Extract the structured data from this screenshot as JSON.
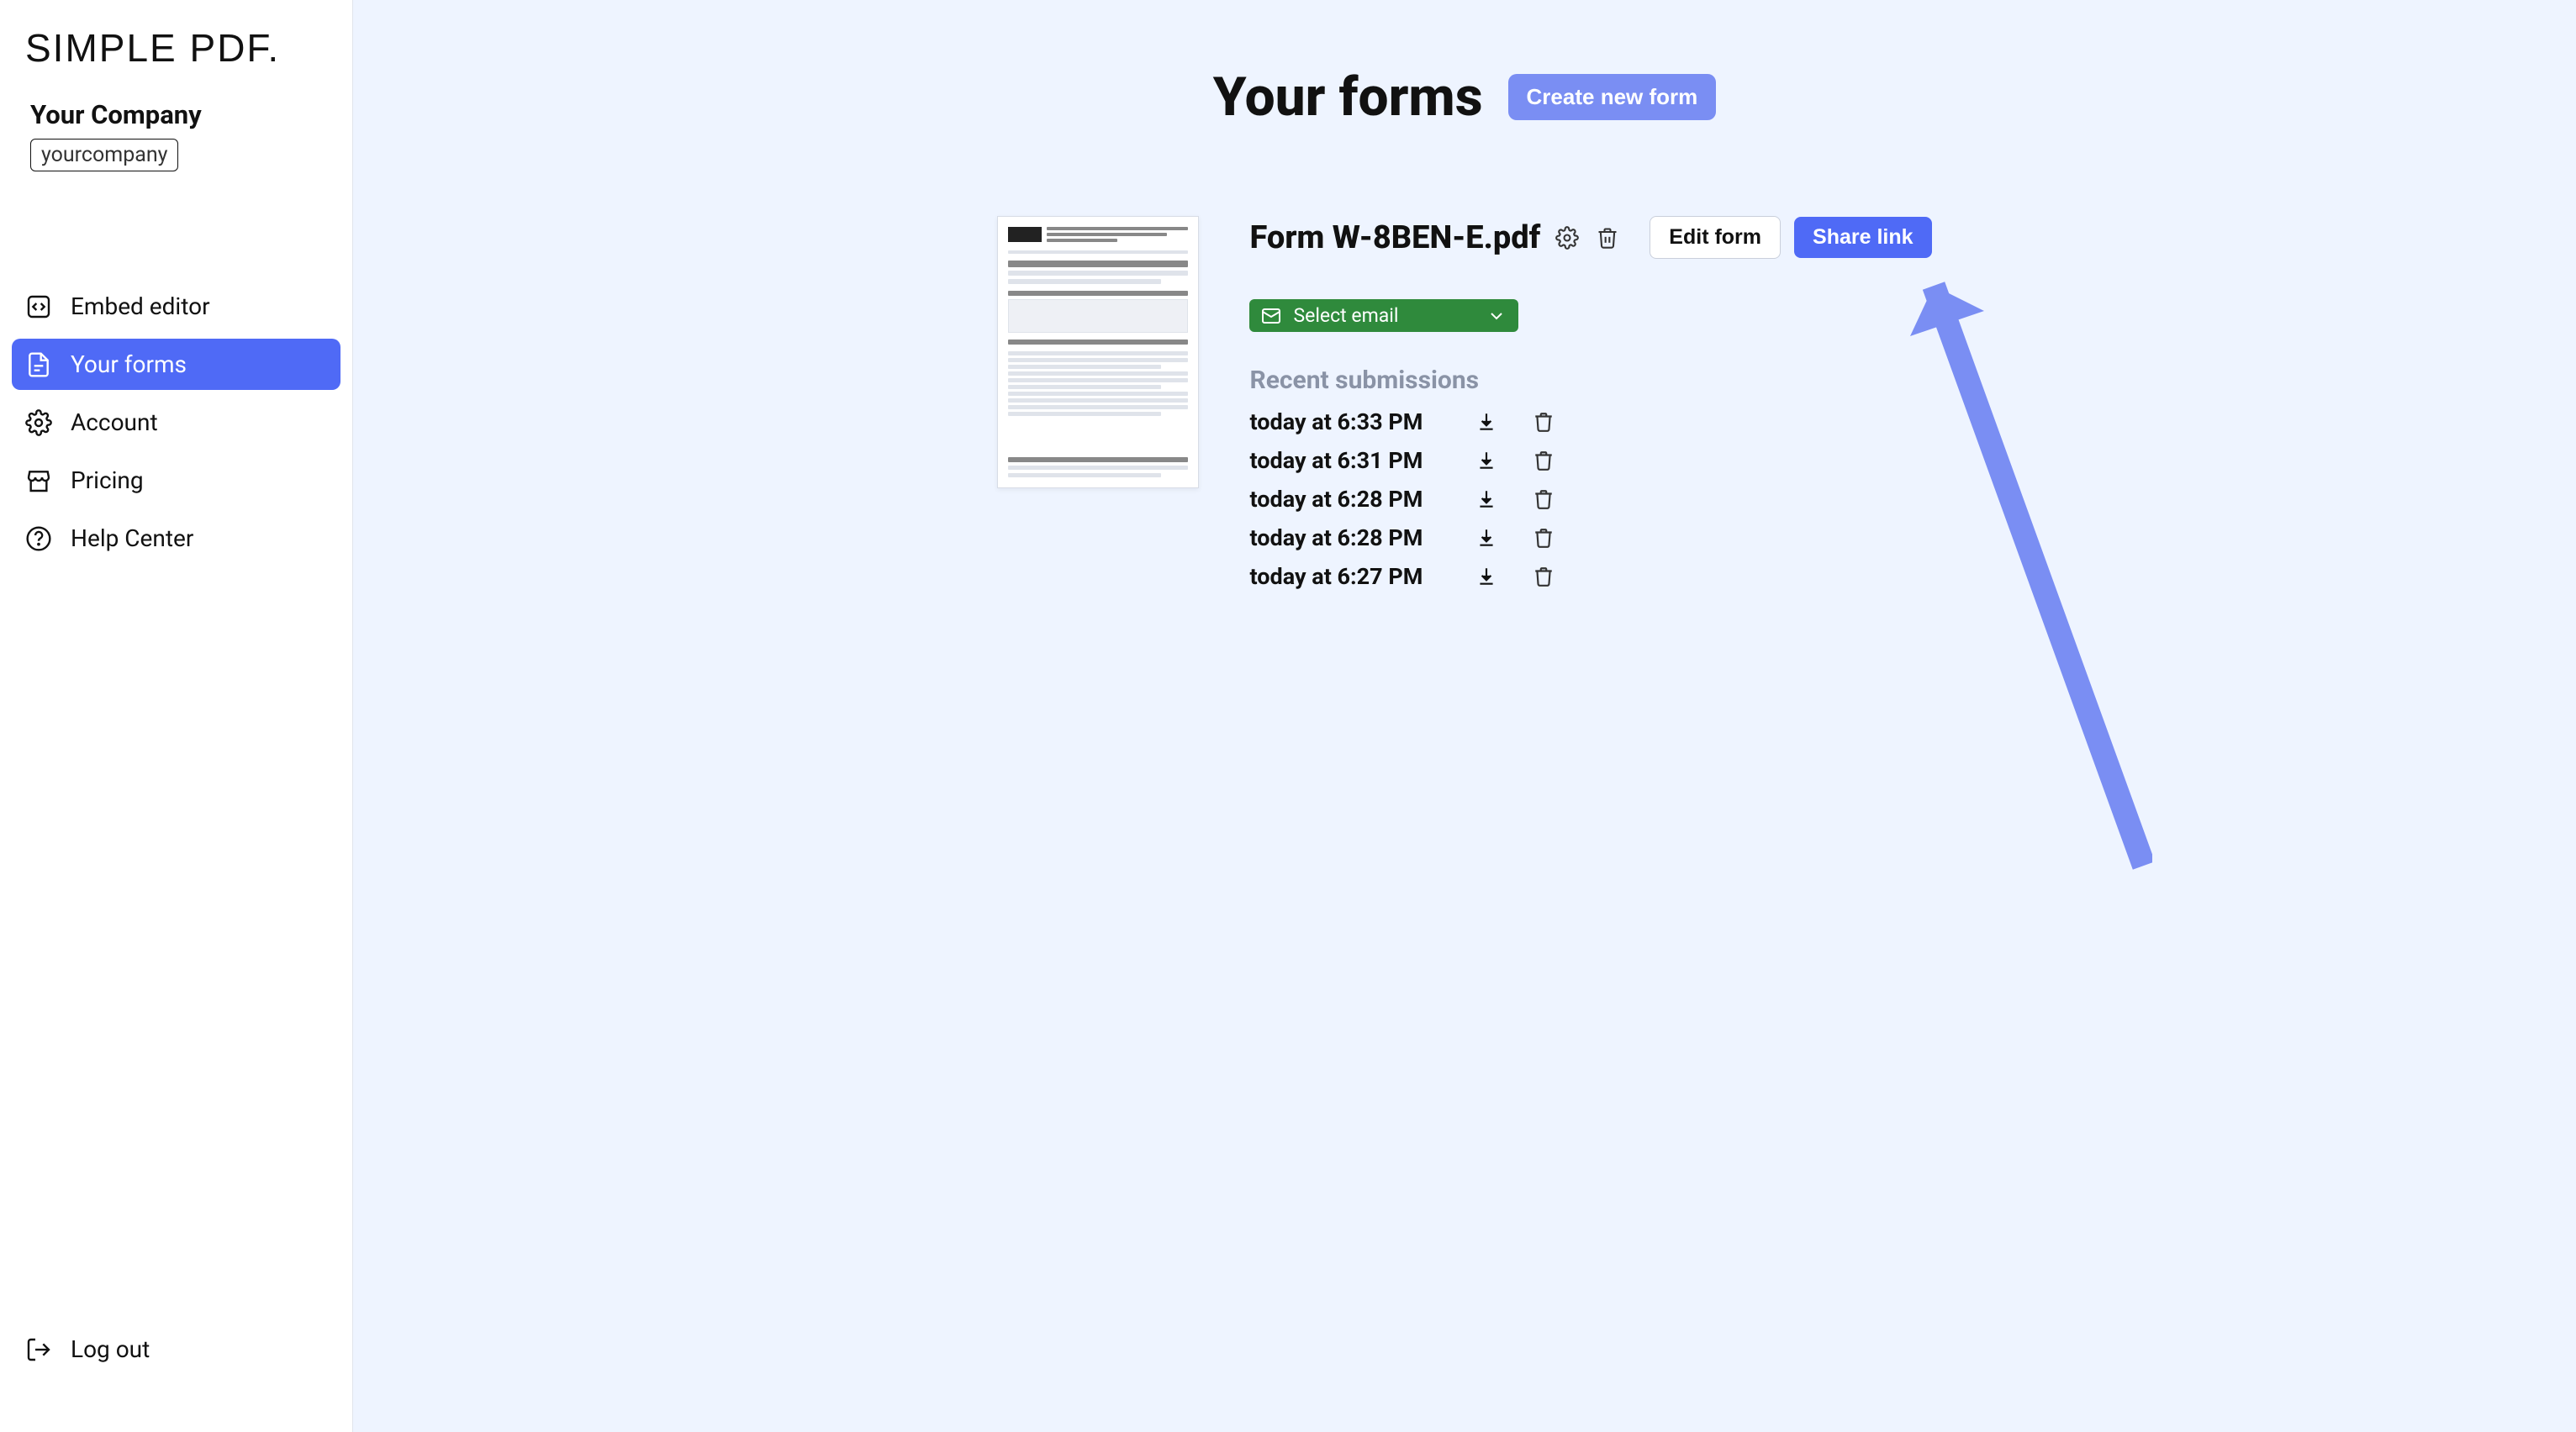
{
  "logo": "SIMPLE PDF.",
  "company": {
    "name": "Your Company",
    "slug": "yourcompany"
  },
  "nav": {
    "embed_editor": "Embed editor",
    "your_forms": "Your forms",
    "account": "Account",
    "pricing": "Pricing",
    "help_center": "Help Center",
    "log_out": "Log out"
  },
  "page": {
    "title": "Your forms",
    "create_button": "Create new form"
  },
  "form": {
    "title": "Form W-8BEN-E.pdf",
    "edit_button": "Edit form",
    "share_button": "Share link",
    "email_select_label": "Select email",
    "recent_heading": "Recent submissions",
    "submissions": [
      {
        "time": "today at 6:33 PM"
      },
      {
        "time": "today at 6:31 PM"
      },
      {
        "time": "today at 6:28 PM"
      },
      {
        "time": "today at 6:28 PM"
      },
      {
        "time": "today at 6:27 PM"
      }
    ]
  }
}
